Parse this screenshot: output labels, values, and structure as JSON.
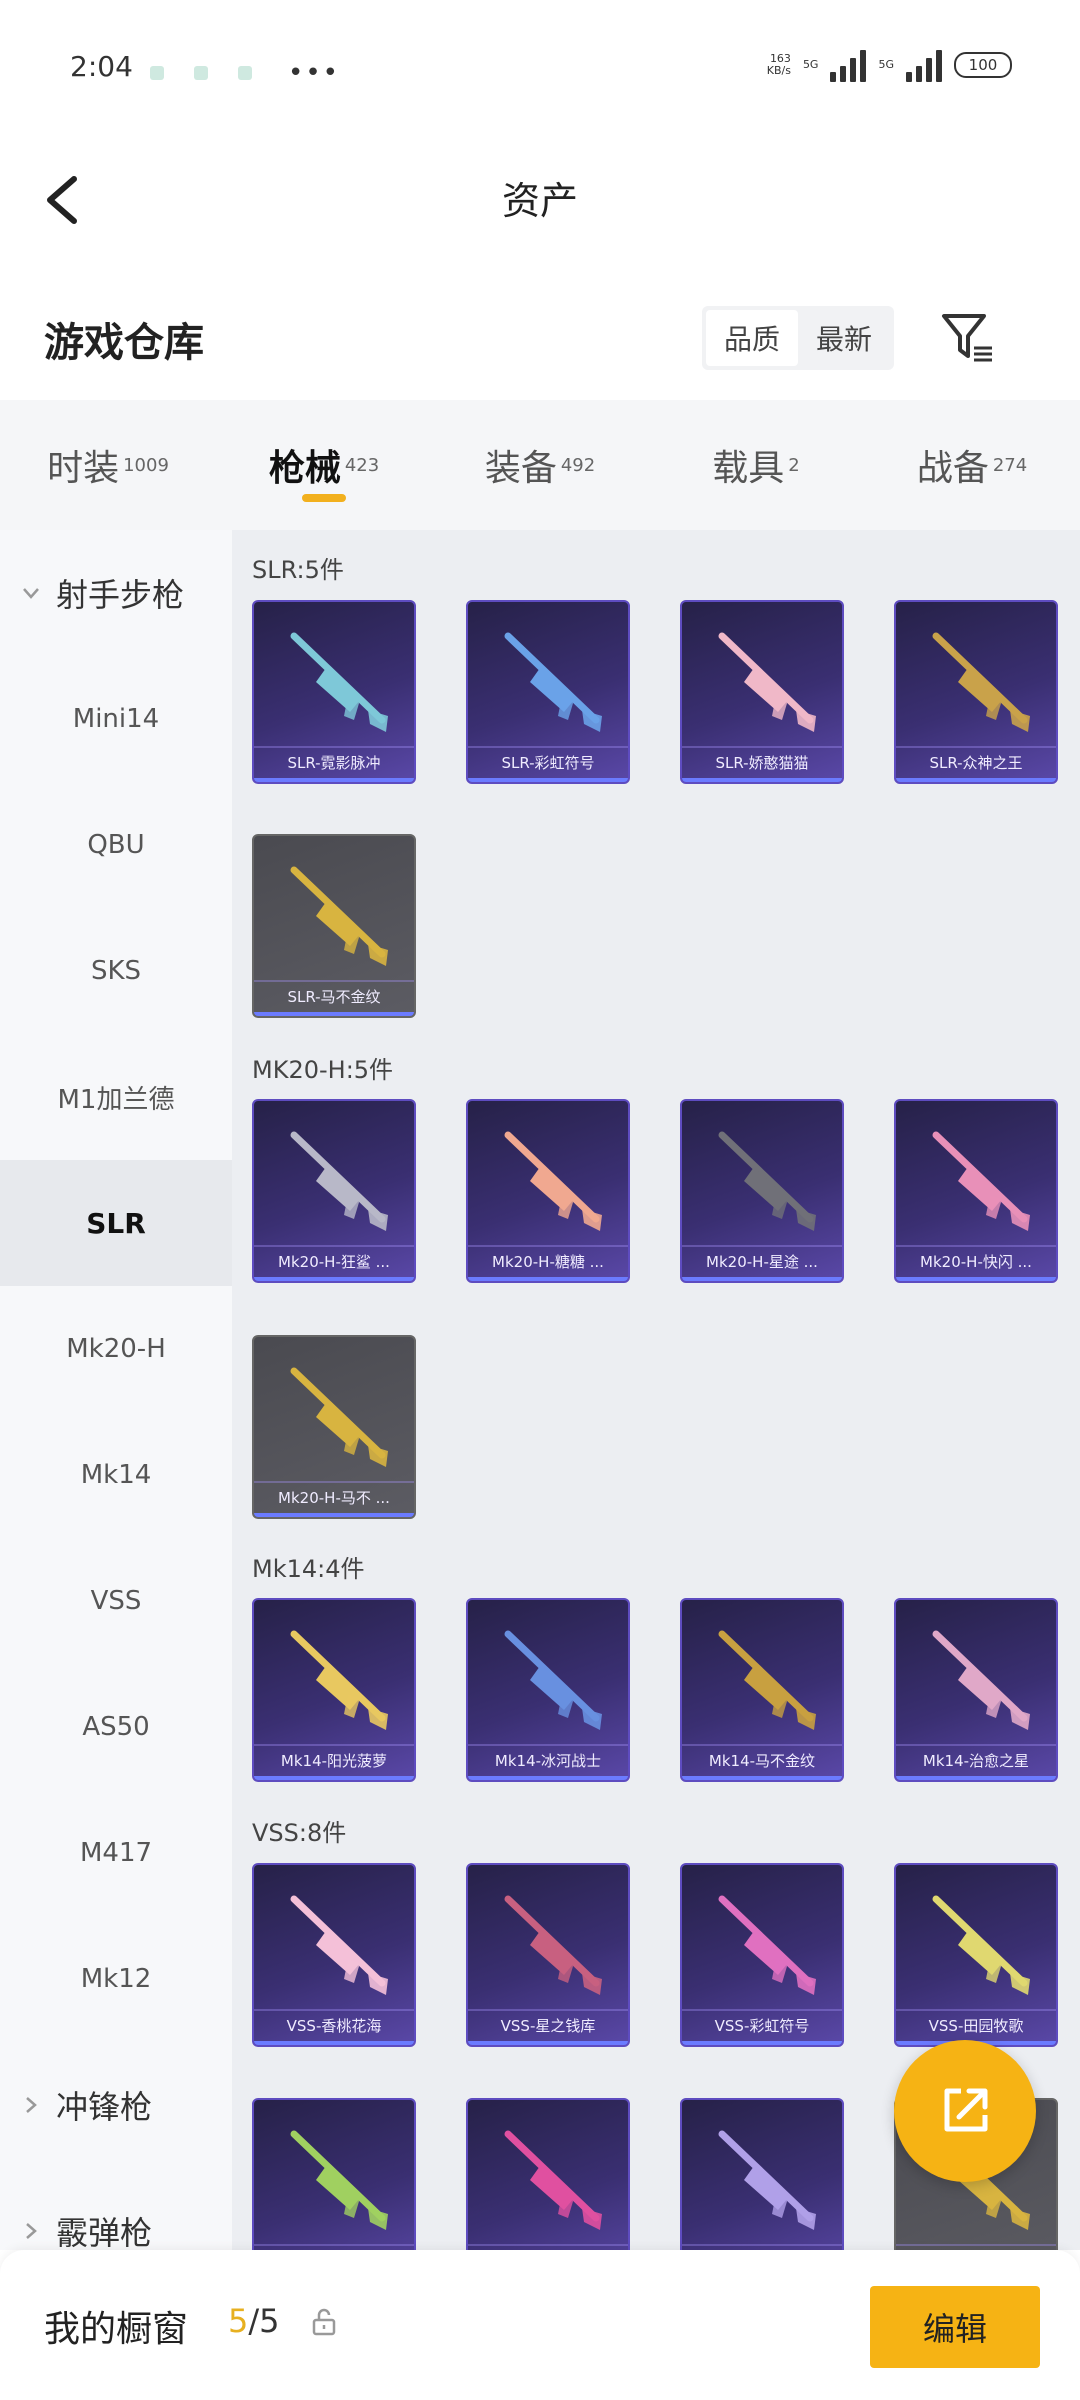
{
  "status_bar": {
    "time": "2:04",
    "more": "•••",
    "net_speed": "163",
    "net_unit": "KB/s",
    "signal1": "5G",
    "signal2": "5G",
    "battery": "100"
  },
  "header": {
    "title": "资产",
    "back_icon": "chevron-left-icon"
  },
  "section": {
    "title": "游戏仓库",
    "sort_options": [
      "品质",
      "最新"
    ],
    "filter_icon": "filter-icon"
  },
  "tabs": [
    {
      "label": "时装",
      "count": "1009"
    },
    {
      "label": "枪械",
      "count": "423"
    },
    {
      "label": "装备",
      "count": "492"
    },
    {
      "label": "载具",
      "count": "2"
    },
    {
      "label": "战备",
      "count": "274"
    }
  ],
  "active_tab_index": 1,
  "sidebar": {
    "group_open": "射手步枪",
    "items": [
      "Mini14",
      "QBU",
      "SKS",
      "M1加兰德",
      "SLR",
      "Mk20-H",
      "Mk14",
      "VSS",
      "AS50",
      "M417",
      "Mk12"
    ],
    "active_item": "SLR",
    "group_collapsed": [
      "冲锋枪",
      "霰弹枪"
    ]
  },
  "groups": [
    {
      "label": "SLR:5件",
      "cards": [
        {
          "name": "SLR-霓影脉冲",
          "style": "purple",
          "gun_color": "#7ec8d8"
        },
        {
          "name": "SLR-彩虹符号",
          "style": "purple",
          "gun_color": "#6aa2e8"
        },
        {
          "name": "SLR-娇憨猫猫",
          "style": "purple",
          "gun_color": "#f0b8c8"
        },
        {
          "name": "SLR-众神之王",
          "style": "purple",
          "gun_color": "#c9a24a"
        },
        {
          "name": "SLR-马不金纹",
          "style": "gray",
          "gun_color": "#d8b440"
        }
      ]
    },
    {
      "label": "MK20-H:5件",
      "cards": [
        {
          "name": "Mk20-H-狂鲨 ...",
          "style": "purple",
          "gun_color": "#b8b8c8"
        },
        {
          "name": "Mk20-H-糖糖 ...",
          "style": "purple",
          "gun_color": "#f0a890"
        },
        {
          "name": "Mk20-H-星途 ...",
          "style": "purple",
          "gun_color": "#707078"
        },
        {
          "name": "Mk20-H-快闪 ...",
          "style": "purple",
          "gun_color": "#e890b8"
        },
        {
          "name": "Mk20-H-马不 ...",
          "style": "gray",
          "gun_color": "#d8b440"
        }
      ]
    },
    {
      "label": "Mk14:4件",
      "cards": [
        {
          "name": "Mk14-阳光菠萝",
          "style": "purple",
          "gun_color": "#e8c860"
        },
        {
          "name": "Mk14-冰河战士",
          "style": "purple",
          "gun_color": "#6890e0"
        },
        {
          "name": "Mk14-马不金纹",
          "style": "purple",
          "gun_color": "#c8a040"
        },
        {
          "name": "Mk14-治愈之星",
          "style": "purple",
          "gun_color": "#e0a8c8"
        }
      ]
    },
    {
      "label": "VSS:8件",
      "cards": [
        {
          "name": "VSS-香桃花海",
          "style": "purple",
          "gun_color": "#f4c0d8"
        },
        {
          "name": "VSS-星之钱库",
          "style": "purple",
          "gun_color": "#c86080"
        },
        {
          "name": "VSS-彩虹符号",
          "style": "purple",
          "gun_color": "#e070c0"
        },
        {
          "name": "VSS-田园牧歌",
          "style": "purple",
          "gun_color": "#e0d870"
        },
        {
          "name": "",
          "style": "purple",
          "gun_color": "#a0d060"
        },
        {
          "name": "",
          "style": "purple",
          "gun_color": "#e050a0"
        },
        {
          "name": "",
          "style": "purple",
          "gun_color": "#b0a0e8"
        },
        {
          "name": "",
          "style": "gray",
          "gun_color": "#d8b440"
        }
      ]
    }
  ],
  "bottom": {
    "label": "我的橱窗",
    "count_current": "5",
    "count_total": "/5",
    "edit_label": "编辑"
  },
  "colors": {
    "accent": "#f6b314",
    "card_purple": "#3a2f72",
    "card_gray": "#55555b"
  }
}
